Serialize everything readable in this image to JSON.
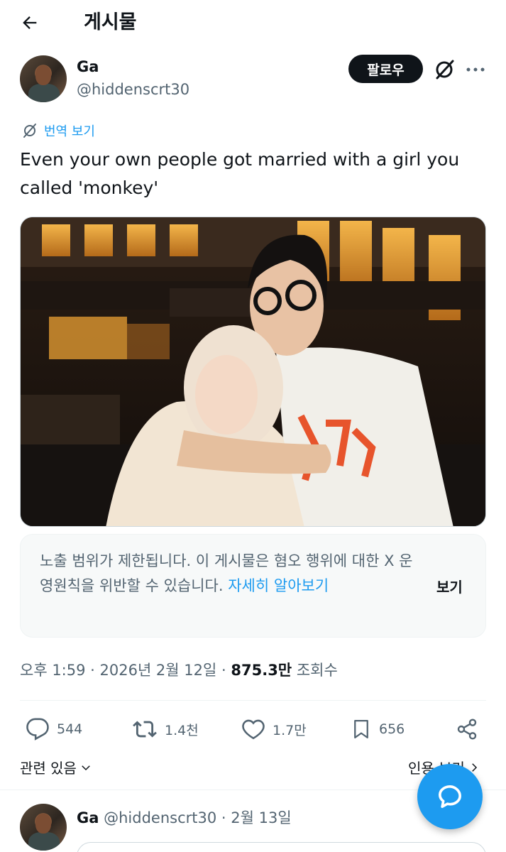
{
  "header": {
    "title": "게시물",
    "back_icon": "arrow-left-icon"
  },
  "post": {
    "author_name": "Ga",
    "author_handle": "@hiddenscrt30",
    "follow_label": "팔로우",
    "translate_label": "번역 보기",
    "text": "Even your own people got married with a girl you called 'monkey'",
    "notice": {
      "text": "노출 범위가 제한됩니다. 이 게시물은 혐오 행위에 대한 X 운영원칙을 위반할 수 있습니다.",
      "link": "자세히 알아보기",
      "view_label": "보기"
    },
    "meta": {
      "time_date": "오후 1:59 · 2026년 2월 12일 · ",
      "views": "875.3만",
      "views_label": "조회수"
    },
    "actions": {
      "replies": "544",
      "reposts": "1.4천",
      "likes": "1.7만",
      "bookmarks": "656"
    },
    "related_label": "관련 있음",
    "quote_label": "인용 보기"
  },
  "reply": {
    "author_name": "Ga",
    "author_handle": "@hiddenscrt30",
    "date": "· 2월 13일"
  },
  "colors": {
    "accent": "#1d9bf0",
    "text": "#0f1419",
    "muted": "#536471"
  }
}
